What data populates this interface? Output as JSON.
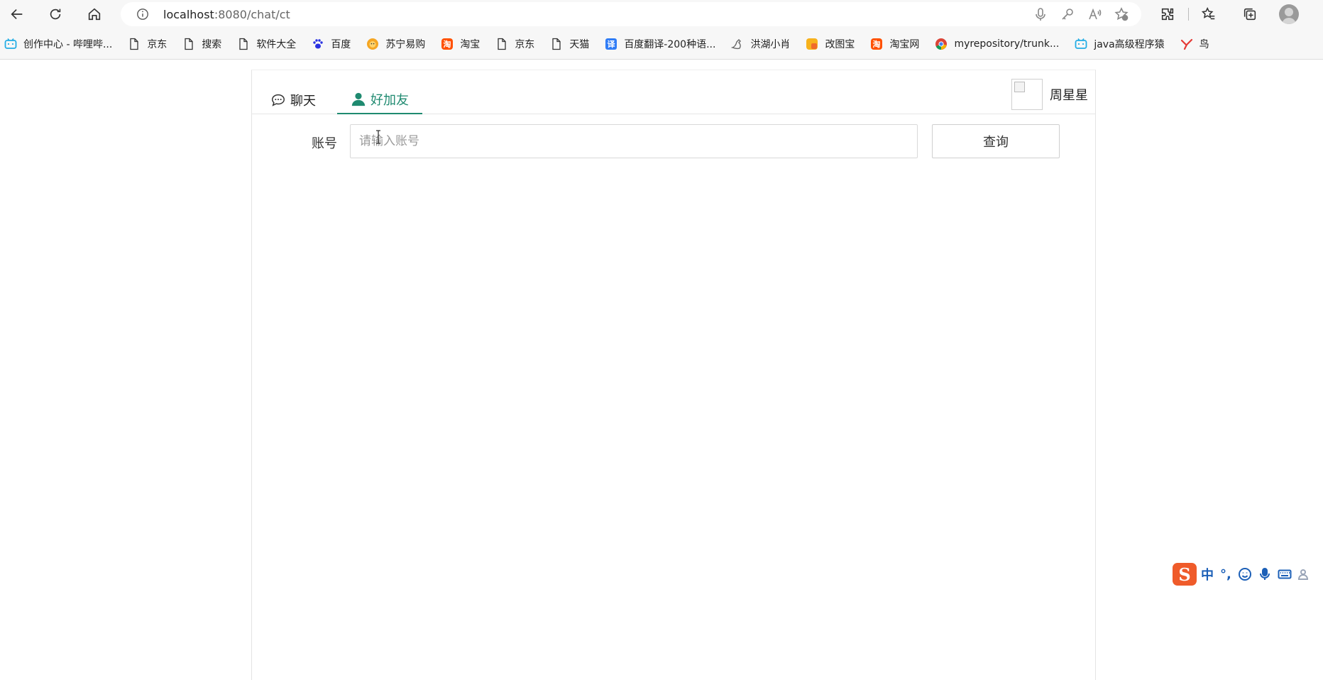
{
  "browser": {
    "url_host": "localhost",
    "url_path": ":8080/chat/ct",
    "bookmarks": [
      {
        "label": "创作中心 - 哔哩哔...",
        "icon": "bilibili-icon",
        "color": "#23ade5"
      },
      {
        "label": "京东",
        "icon": "page-icon"
      },
      {
        "label": "搜索",
        "icon": "page-icon"
      },
      {
        "label": "软件大全",
        "icon": "page-icon"
      },
      {
        "label": "百度",
        "icon": "baidu-paw-icon",
        "color": "#2932e1"
      },
      {
        "label": "苏宁易购",
        "icon": "suning-lion-icon",
        "color": "#f5a623"
      },
      {
        "label": "淘宝",
        "icon": "taobao-icon",
        "color": "#ff5000"
      },
      {
        "label": "京东",
        "icon": "page-icon"
      },
      {
        "label": "天猫",
        "icon": "page-icon"
      },
      {
        "label": "百度翻译-200种语...",
        "icon": "translate-icon",
        "color": "#2f7cf6"
      },
      {
        "label": "洪湖小肖",
        "icon": "bird-icon",
        "color": "#666666"
      },
      {
        "label": "改图宝",
        "icon": "gaitubao-icon",
        "color": "#f7b21c"
      },
      {
        "label": "淘宝网",
        "icon": "taobao-icon",
        "color": "#ff5000"
      },
      {
        "label": "myrepository/trunk...",
        "icon": "chrome-icon",
        "color": "#4285f4"
      },
      {
        "label": "java高级程序猿",
        "icon": "bilibili-icon",
        "color": "#23ade5"
      },
      {
        "label": "鸟",
        "icon": "bird-red-icon",
        "color": "#e53935"
      }
    ]
  },
  "app": {
    "tabs": {
      "chat": "聊天",
      "add_friend": "好加友"
    },
    "user": {
      "name": "周星星"
    },
    "search": {
      "label": "账号",
      "placeholder": "请输入账号",
      "value": "",
      "button": "查询"
    },
    "accent_color": "#1f8a70"
  },
  "ime": {
    "mode": "中",
    "punct": "°,"
  }
}
